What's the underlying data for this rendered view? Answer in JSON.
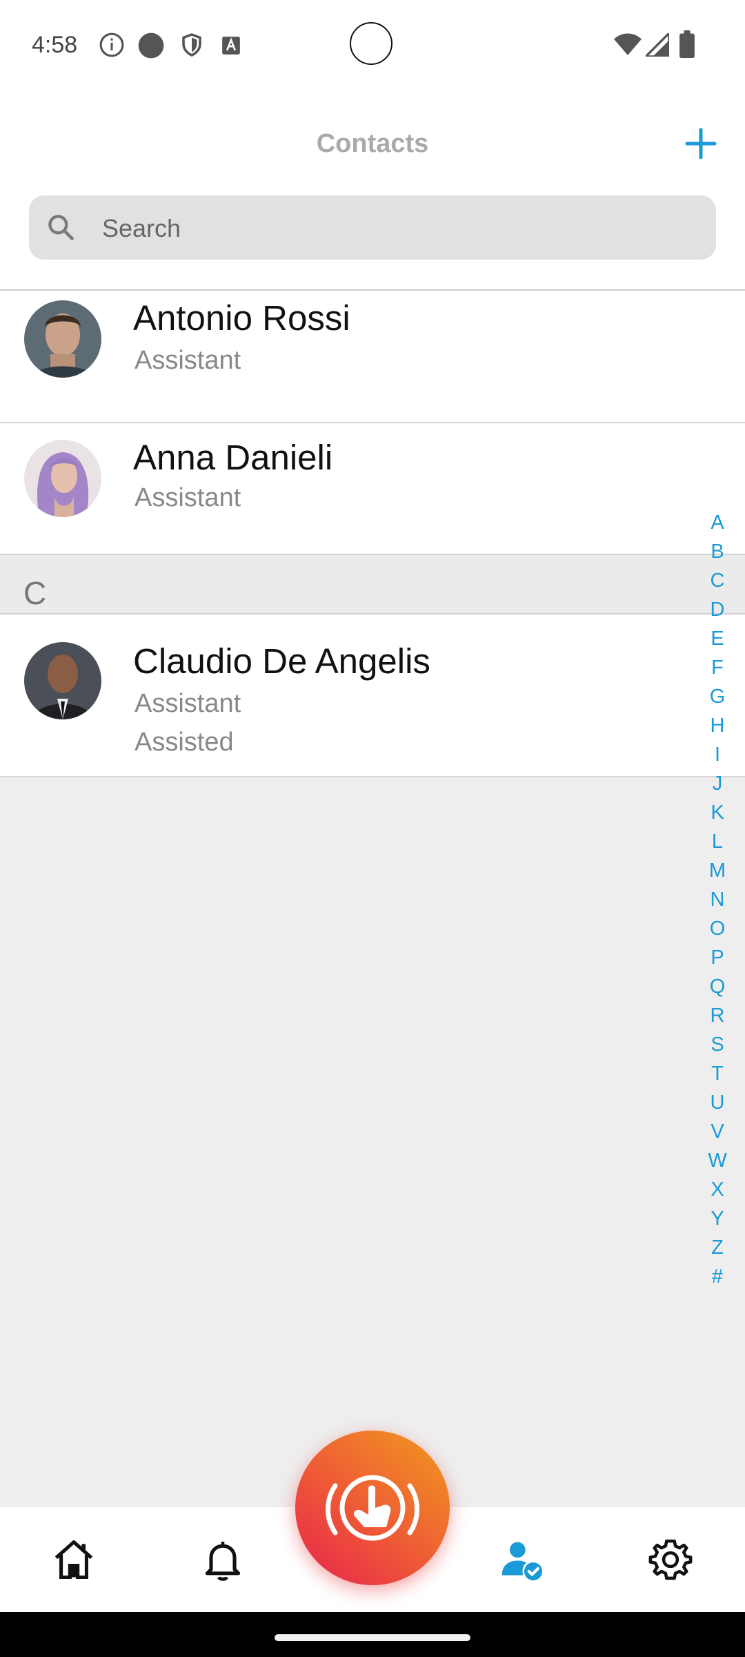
{
  "status_bar": {
    "time": "4:58",
    "icons": [
      "info-icon",
      "circle-icon",
      "shield-icon",
      "font-icon",
      "wifi-icon",
      "signal-icon",
      "battery-icon"
    ]
  },
  "header": {
    "title": "Contacts",
    "add_icon": "plus-icon"
  },
  "search": {
    "placeholder": "Search",
    "value": ""
  },
  "contacts": [
    {
      "name": "Antonio Rossi",
      "subtitle": "Assistant"
    },
    {
      "name": "Anna Danieli",
      "subtitle": "Assistant"
    }
  ],
  "section_c": {
    "letter": "C",
    "contacts": [
      {
        "name": "Claudio De Angelis",
        "subtitle": "Assistant",
        "subtitle2": "Assisted"
      }
    ]
  },
  "alphabet_index": [
    "A",
    "B",
    "C",
    "D",
    "E",
    "F",
    "G",
    "H",
    "I",
    "J",
    "K",
    "L",
    "M",
    "N",
    "O",
    "P",
    "Q",
    "R",
    "S",
    "T",
    "U",
    "V",
    "W",
    "X",
    "Y",
    "Z",
    "#"
  ],
  "bottom_nav": {
    "items": [
      "home-icon",
      "bell-icon",
      "sos-touch-icon",
      "contacts-icon",
      "gear-icon"
    ],
    "active": "contacts-icon"
  },
  "colors": {
    "accent": "#1a9ad6",
    "fab_start": "#e8224d",
    "fab_end": "#f19a1f"
  }
}
